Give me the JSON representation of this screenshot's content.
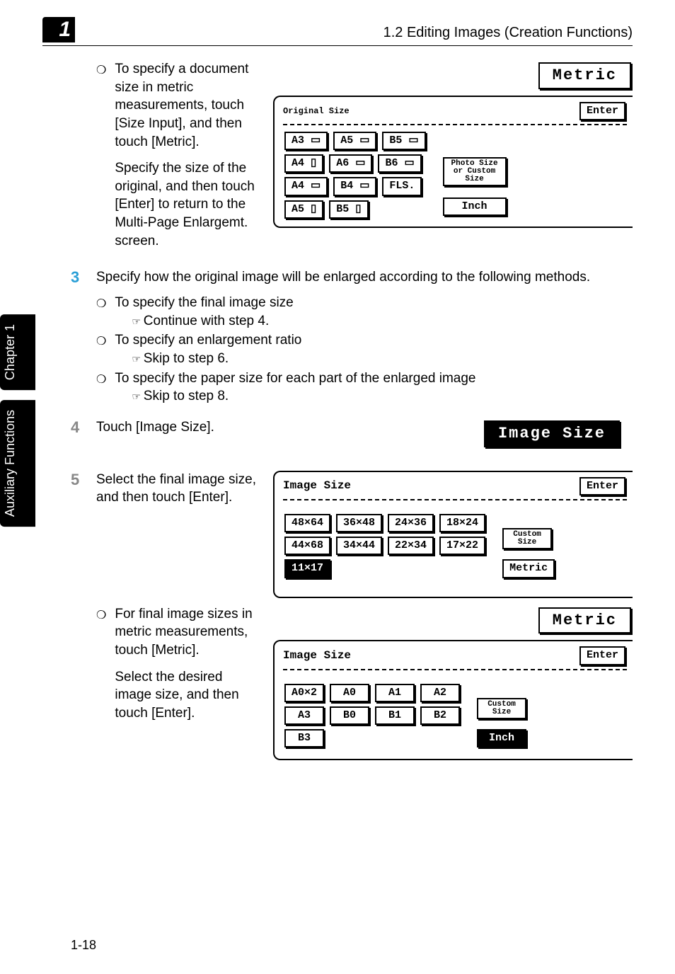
{
  "header": {
    "chapter_num": "1",
    "title": "1.2 Editing Images (Creation Functions)"
  },
  "side_tabs": [
    "Chapter 1",
    "Auxiliary Functions"
  ],
  "footer": "1-18",
  "step2_bullet": {
    "p1": "To specify a document size in metric measurements, touch [Size Input], and then touch [Metric].",
    "p2": "Specify the size of the original, and then touch [Enter] to return to the Multi-Page Enlargemt. screen."
  },
  "screen_original": {
    "metric_btn": "Metric",
    "title": "Original Size",
    "enter": "Enter",
    "rows": [
      [
        "A3 ▭",
        "A5 ▭",
        "B5 ▭"
      ],
      [
        "A4 ▯",
        "A6 ▭",
        "B6 ▭"
      ],
      [
        "A4 ▭",
        "B4 ▭",
        "FLS."
      ],
      [
        "A5 ▯",
        "B5 ▯"
      ]
    ],
    "photo_btn": "Photo Size or Custom Size",
    "inch_btn": "Inch"
  },
  "step3": {
    "text": "Specify how the original image will be enlarged according to the following methods.",
    "items": [
      {
        "t": "To specify the final image size",
        "s": "Continue with step 4."
      },
      {
        "t": "To specify an enlargement ratio",
        "s": "Skip to step 6."
      },
      {
        "t": "To specify the paper size for each part of the enlarged image",
        "s": "Skip to step 8."
      }
    ]
  },
  "step4": {
    "text": "Touch [Image Size].",
    "chip": "Image Size"
  },
  "step5": {
    "text": "Select the final image size, and then touch [Enter].",
    "bullet_p1": "For final image sizes in metric measurements, touch [Metric].",
    "bullet_p2": "Select the desired image size, and then touch [Enter]."
  },
  "screen_image_inch": {
    "title": "Image Size",
    "enter": "Enter",
    "rows": [
      [
        "48×64",
        "36×48",
        "24×36",
        "18×24"
      ],
      [
        "44×68",
        "34×44",
        "22×34",
        "17×22"
      ],
      [
        "11×17"
      ]
    ],
    "selected": "11×17",
    "custom": "Custom Size",
    "metric": "Metric"
  },
  "screen_image_metric": {
    "metric_btn": "Metric",
    "title": "Image Size",
    "enter": "Enter",
    "rows": [
      [
        "A0×2",
        "A0",
        "A1",
        "A2"
      ],
      [
        "A3",
        "B0",
        "B1",
        "B2"
      ],
      [
        "B3"
      ]
    ],
    "custom": "Custom Size",
    "inch": "Inch"
  }
}
